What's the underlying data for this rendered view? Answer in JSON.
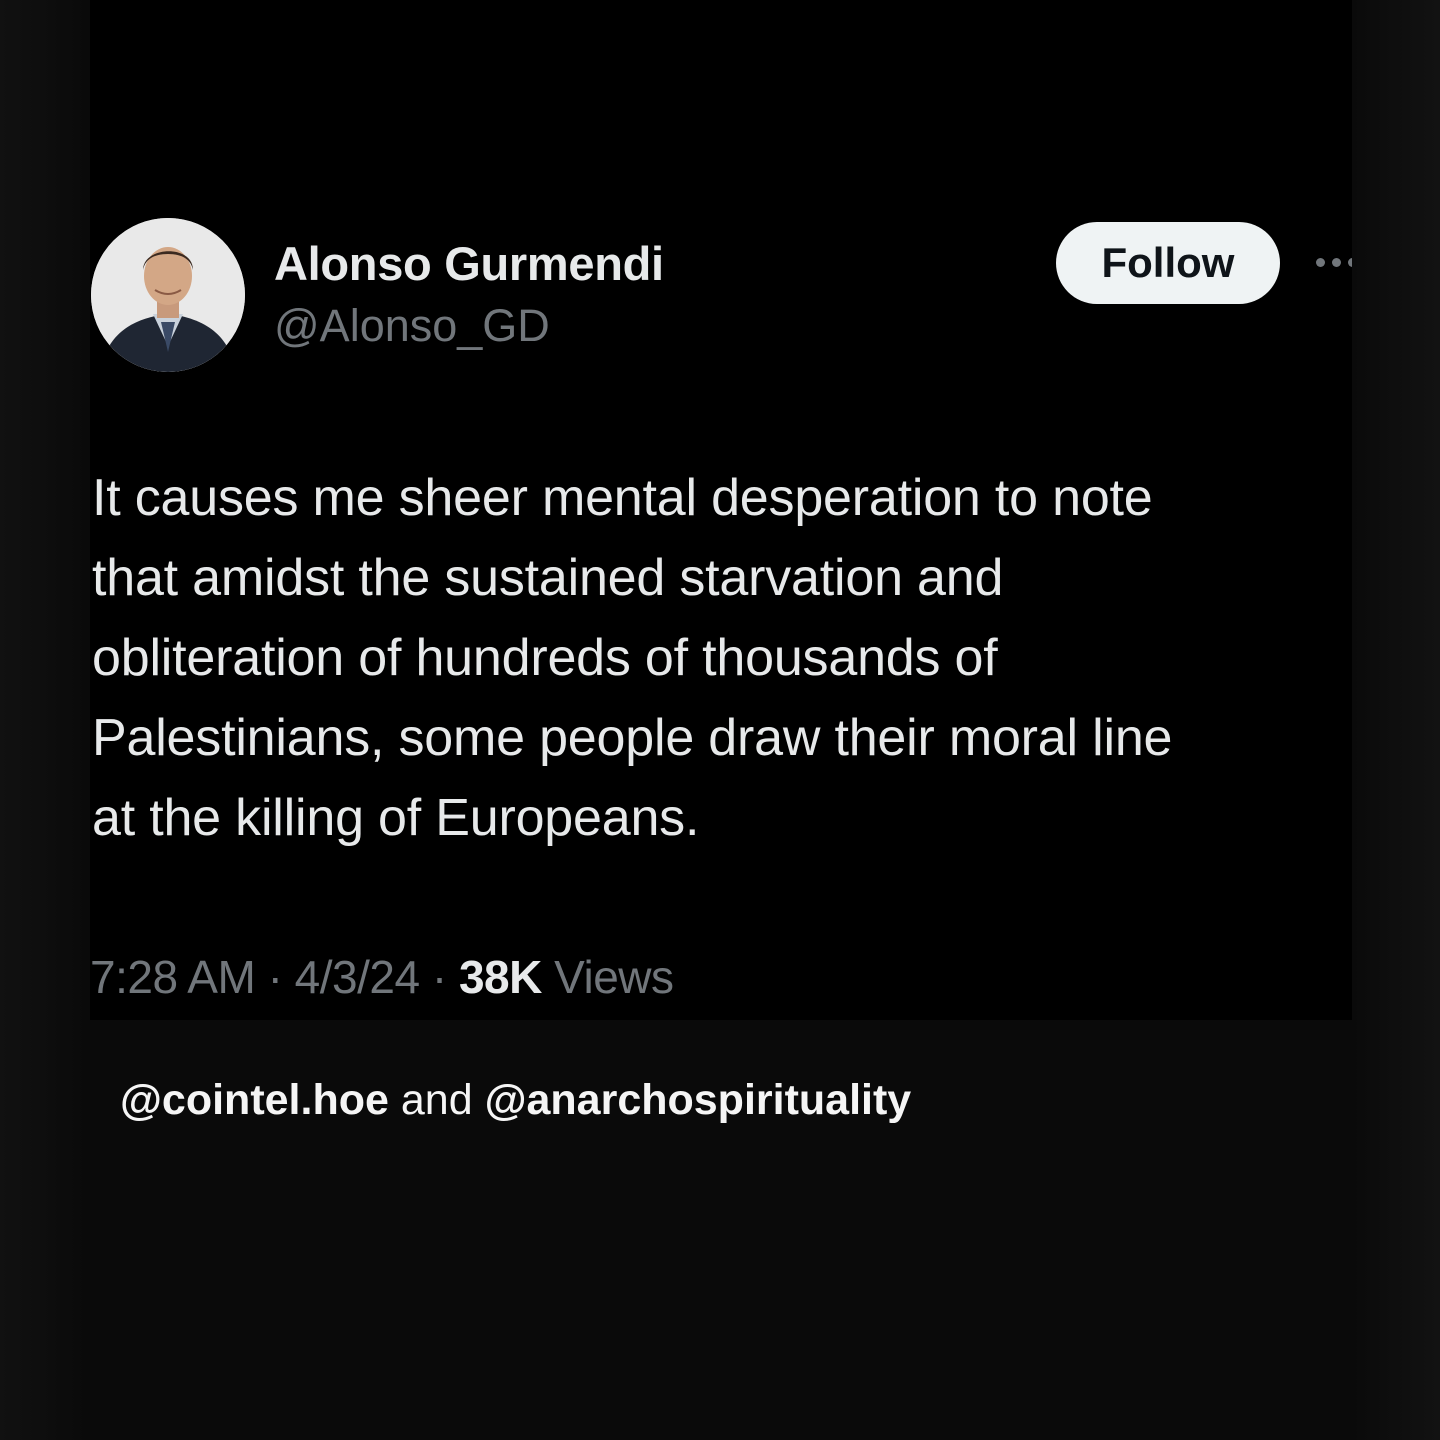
{
  "tweet": {
    "display_name": "Alonso Gurmendi",
    "handle": "@Alonso_GD",
    "follow_label": "Follow",
    "text_lines": [
      "It causes me sheer mental desperation to note",
      "that amidst the sustained starvation and",
      "obliteration of hundreds of thousands of",
      "Palestinians, some people draw their moral line",
      "at the killing of Europeans."
    ],
    "time": "7:28 AM",
    "separator": "·",
    "date": "4/3/24",
    "views_count": "38K",
    "views_label": "Views"
  },
  "caption": {
    "mention_1": "@cointel.hoe",
    "conjunction": "and",
    "mention_2": "@anarchospirituality"
  },
  "icons": {
    "avatar": "profile-photo",
    "more": "more-options-icon"
  },
  "colors": {
    "background": "#000000",
    "text_primary": "#e7e9ea",
    "text_secondary": "#71767b",
    "follow_button_bg": "#eff3f4",
    "follow_button_text": "#0f1419"
  }
}
